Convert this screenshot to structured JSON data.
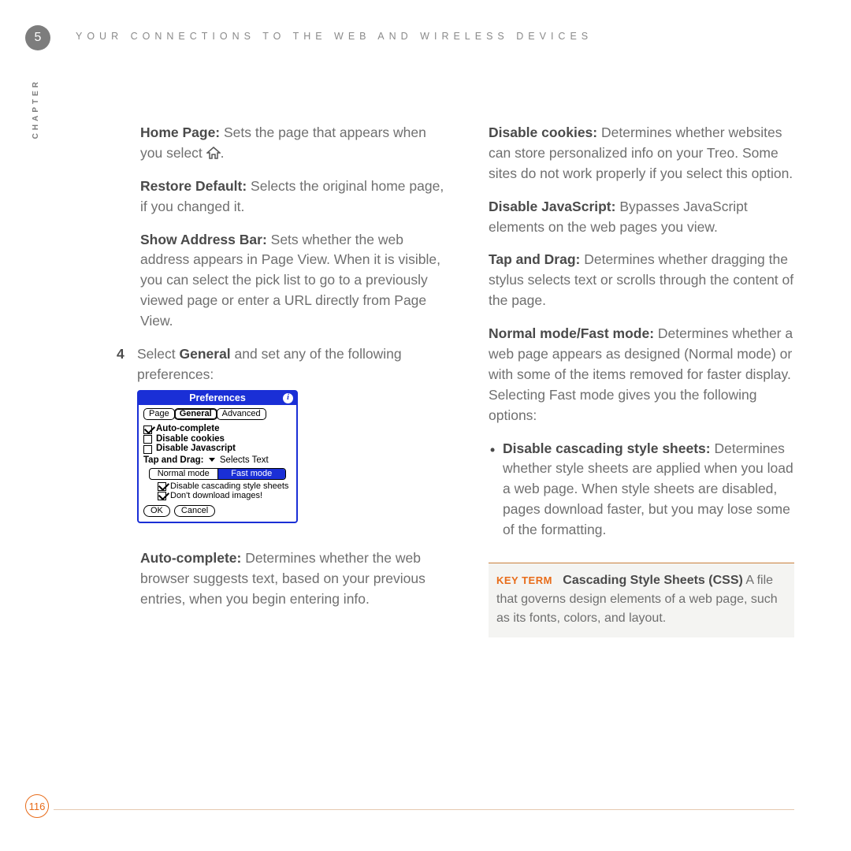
{
  "header": {
    "chapter_number": "5",
    "running_head": "YOUR CONNECTIONS TO THE WEB AND WIRELESS DEVICES",
    "vertical_label": "CHAPTER"
  },
  "left_col": {
    "home_page": {
      "label": "Home Page:",
      "text": " Sets the page that appears when you select ",
      "tail": "."
    },
    "restore_default": {
      "label": "Restore Default:",
      "text": " Selects the original home page, if you changed it."
    },
    "show_address": {
      "label": "Show Address Bar:",
      "text": " Sets whether the web address appears in Page View. When it is visible, you can select the pick list to go to a previously viewed page or enter a URL directly from Page View."
    },
    "step4": {
      "num": "4",
      "pre": "Select ",
      "bold": "General",
      "post": " and set any of the following preferences:"
    },
    "auto_complete": {
      "label": "Auto-complete:",
      "text": " Determines whether the web browser suggests text, based on your previous entries, when you begin entering info."
    }
  },
  "right_col": {
    "disable_cookies": {
      "label": "Disable cookies:",
      "text": " Determines whether websites can store personalized info on your Treo. Some sites do not work properly if you select this option."
    },
    "disable_js": {
      "label": "Disable JavaScript:",
      "text": " Bypasses JavaScript elements on the web pages you view."
    },
    "tap_drag": {
      "label": "Tap and Drag:",
      "text": " Determines whether dragging the stylus selects text or scrolls through the content of the page."
    },
    "modes": {
      "label": "Normal mode/Fast mode:",
      "text": " Determines whether a web page appears as designed (Normal mode) or with some of the items removed for faster display. Selecting Fast mode gives you the following options:"
    },
    "bullet_css": {
      "label": "Disable cascading style sheets:",
      "text": " Determines whether style sheets are applied when you load a web page. When style sheets are disabled, pages download faster, but you may lose some of the formatting."
    },
    "keyterm": {
      "tag": "KEY TERM",
      "term": "Cascading Style Sheets (CSS)",
      "text": "   A file that governs design elements of a web page, such as its fonts, colors, and layout."
    }
  },
  "prefs": {
    "title": "Preferences",
    "tabs": [
      "Page",
      "General",
      "Advanced"
    ],
    "selected_tab": "General",
    "checks": [
      {
        "label": "Auto-complete",
        "checked": true
      },
      {
        "label": "Disable cookies",
        "checked": false
      },
      {
        "label": "Disable Javascript",
        "checked": false
      }
    ],
    "tap_drag_label": "Tap and Drag:",
    "tap_drag_value": "Selects Text",
    "mode_normal": "Normal mode",
    "mode_fast": "Fast mode",
    "sub_checks": [
      {
        "label": "Disable cascading style sheets",
        "checked": true
      },
      {
        "label": "Don't download images!",
        "checked": true
      }
    ],
    "ok": "OK",
    "cancel": "Cancel"
  },
  "footer": {
    "page_number": "116"
  }
}
